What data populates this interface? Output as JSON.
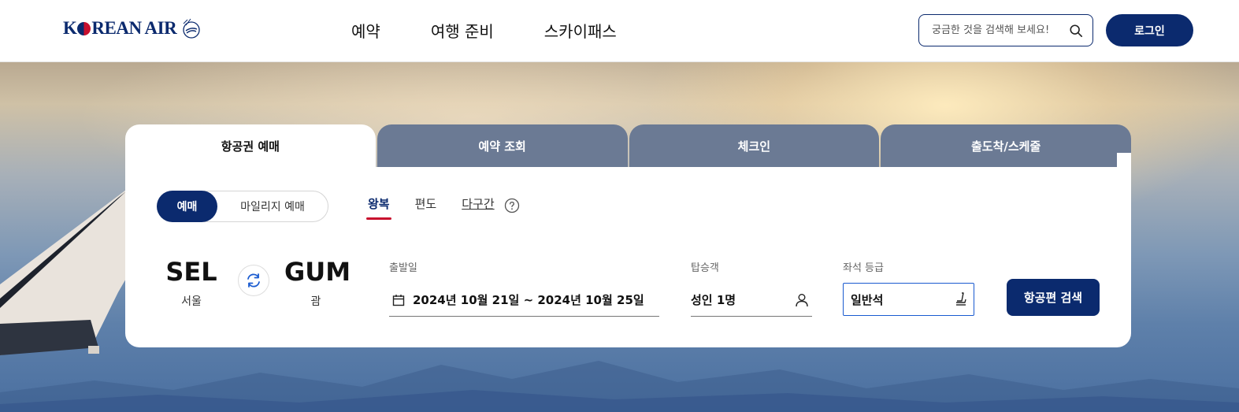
{
  "header": {
    "logo_text_k": "K",
    "logo_text_rest": "REAN AIR",
    "nav": [
      "예약",
      "여행 준비",
      "스카이패스"
    ],
    "search_placeholder": "궁금한 것을 검색해 보세요!",
    "login_label": "로그인"
  },
  "booking": {
    "tabs": [
      "항공권 예매",
      "예약 조회",
      "체크인",
      "출도착/스케줄"
    ],
    "active_tab": "항공권 예매",
    "mode": {
      "active": "예매",
      "inactive": "마일리지 예매"
    },
    "trip_types": [
      "왕복",
      "편도",
      "다구간"
    ],
    "selected_trip_type": "왕복",
    "origin": {
      "code": "SEL",
      "city": "서울"
    },
    "destination": {
      "code": "GUM",
      "city": "괌"
    },
    "date_label": "출발일",
    "date_value": "2024년 10월 21일 ~ 2024년 10월 25일",
    "pax_label": "탑승객",
    "pax_value": "성인 1명",
    "class_label": "좌석 등급",
    "class_value": "일반석",
    "search_button": "항공편 검색"
  },
  "colors": {
    "brand_navy": "#0b2a6e",
    "accent_red": "#c8102e",
    "tab_inactive": "#6b7a94",
    "focus_blue": "#1a5bd0"
  },
  "icons": [
    "search-icon",
    "help-icon",
    "swap-icon",
    "calendar-icon",
    "person-icon",
    "seat-icon"
  ]
}
